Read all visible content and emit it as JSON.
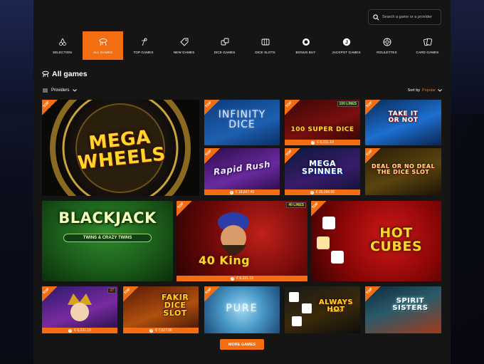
{
  "search": {
    "placeholder": "Search a game or a provider"
  },
  "categories": [
    {
      "label": "SELECTION",
      "icon": "cherry-icon"
    },
    {
      "label": "ALL GAMES",
      "icon": "all-games-icon"
    },
    {
      "label": "TOP GAMES",
      "icon": "top-games-icon"
    },
    {
      "label": "NEW GAMES",
      "icon": "tag-icon"
    },
    {
      "label": "DICE GAMES",
      "icon": "dice-icon"
    },
    {
      "label": "DICE SLOTS",
      "icon": "slot-reel-icon"
    },
    {
      "label": "BONUS BUY",
      "icon": "bonus-chip-icon"
    },
    {
      "label": "JACKPOT GAMES",
      "icon": "jackpot-icon"
    },
    {
      "label": "ROULETTES",
      "icon": "roulette-icon"
    },
    {
      "label": "CARD GAMES",
      "icon": "cards-icon"
    }
  ],
  "active_category": "ALL GAMES",
  "heading": {
    "title": "All games"
  },
  "filters": {
    "providers_label": "Providers",
    "sort_label": "Sort by",
    "sort_value": "Popular"
  },
  "badge_label": "TOP",
  "games": {
    "mega_wheels": {
      "name": "MEGA WHEELS"
    },
    "infinity_dice": {
      "name": "INFINITY DICE"
    },
    "super_dice": {
      "name": "100 SUPER DICE",
      "lines": "100 LINES",
      "jackpot": "€ 6,231.19"
    },
    "take_it": {
      "name": "TAKE IT OR NOT"
    },
    "rapid_rush": {
      "name": "Rapid Rush",
      "jackpot": "€ 18,847.49"
    },
    "mega_spinner": {
      "name": "MEGA SPINNER",
      "jackpot": "€ 25,000.00"
    },
    "deal_or_no_deal": {
      "name": "DEAL OR NO DEAL THE DICE SLOT"
    },
    "blackjack": {
      "name": "BLACKJACK",
      "sub": "TWINS & CRAZY TWINS"
    },
    "king": {
      "name": "40 King",
      "lines": "40 LINES",
      "jackpot": "€ 6,231.19"
    },
    "hot_cubes": {
      "name": "HOT CUBES"
    },
    "joker": {
      "name": "",
      "lines": "27",
      "jackpot": "€ 6,231.19"
    },
    "fakir": {
      "name": "FAKIR DICE SLOT",
      "jackpot": "€ 7,027.06"
    },
    "pure": {
      "name": "PURE"
    },
    "always_hot": {
      "name": "ALWAYS HOT",
      "sub": "cubes"
    },
    "spirit": {
      "name": "SPIRIT SISTERS"
    }
  },
  "more_button": "MORE GAMES",
  "colors": {
    "accent": "#f36d12",
    "bg": "#151515",
    "gold": "#ffd52a"
  }
}
